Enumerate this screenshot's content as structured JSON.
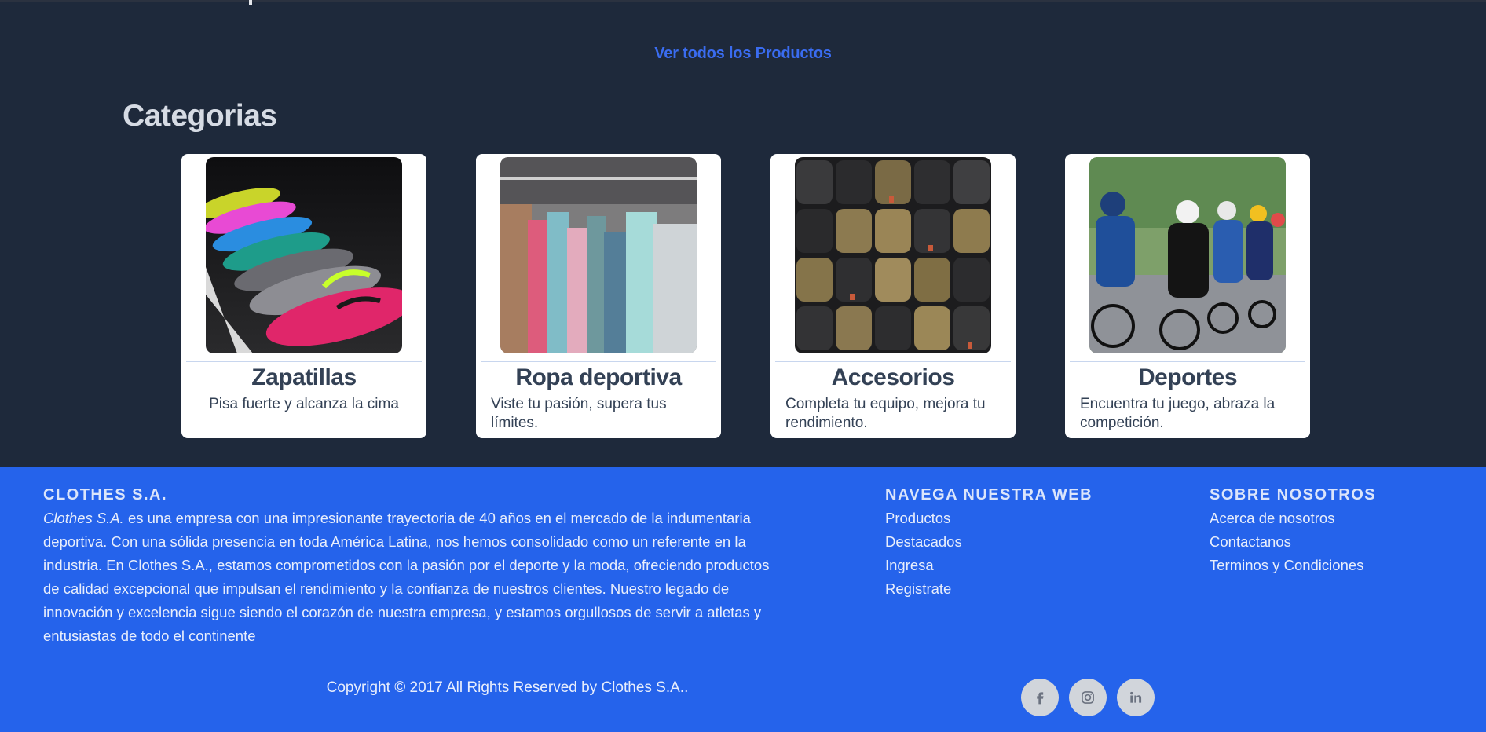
{
  "products": {
    "view_all_label": "Ver todos los Productos"
  },
  "categories": {
    "title": "Categorias",
    "items": [
      {
        "title": "Zapatillas",
        "description": "Pisa fuerte y alcanza la cima",
        "image": "sneakers-photo"
      },
      {
        "title": "Ropa deportiva",
        "description": "Viste tu pasión, supera tus límites.",
        "image": "clothing-rack-photo"
      },
      {
        "title": "Accesorios",
        "description": "Completa tu equipo, mejora tu rendimiento.",
        "image": "backpacks-photo"
      },
      {
        "title": "Deportes",
        "description": "Encuentra tu juego, abraza la competición.",
        "image": "cyclists-photo"
      }
    ]
  },
  "footer": {
    "about": {
      "title": "CLOTHES S.A.",
      "brand": "Clothes S.A.",
      "text": " es una empresa con una impresionante trayectoria de 40 años en el mercado de la indumentaria deportiva. Con una sólida presencia en toda América Latina, nos hemos consolidado como un referente en la industria. En Clothes S.A., estamos comprometidos con la pasión por el deporte y la moda, ofreciendo productos de calidad excepcional que impulsan el rendimiento y la confianza de nuestros clientes. Nuestro legado de innovación y excelencia sigue siendo el corazón de nuestra empresa, y estamos orgullosos de servir a atletas y entusiastas de todo el continente"
    },
    "nav": {
      "title": "NAVEGA NUESTRA WEB",
      "links": [
        "Productos",
        "Destacados",
        "Ingresa",
        "Registrate"
      ]
    },
    "about_us": {
      "title": "SOBRE NOSOTROS",
      "links": [
        "Acerca de nosotros",
        "Contactanos",
        "Terminos y Condiciones"
      ]
    },
    "copyright": "Copyright © 2017 All Rights Reserved by Clothes S.A..",
    "social": [
      "facebook-icon",
      "instagram-icon",
      "linkedin-icon"
    ],
    "colors": {
      "background": "#2563eb",
      "social_bg": "#d1d5db",
      "social_icon": "#6b7280"
    }
  },
  "colors": {
    "page_bg": "#1e293b",
    "link": "#3a6cf0",
    "card_bg": "#ffffff"
  }
}
